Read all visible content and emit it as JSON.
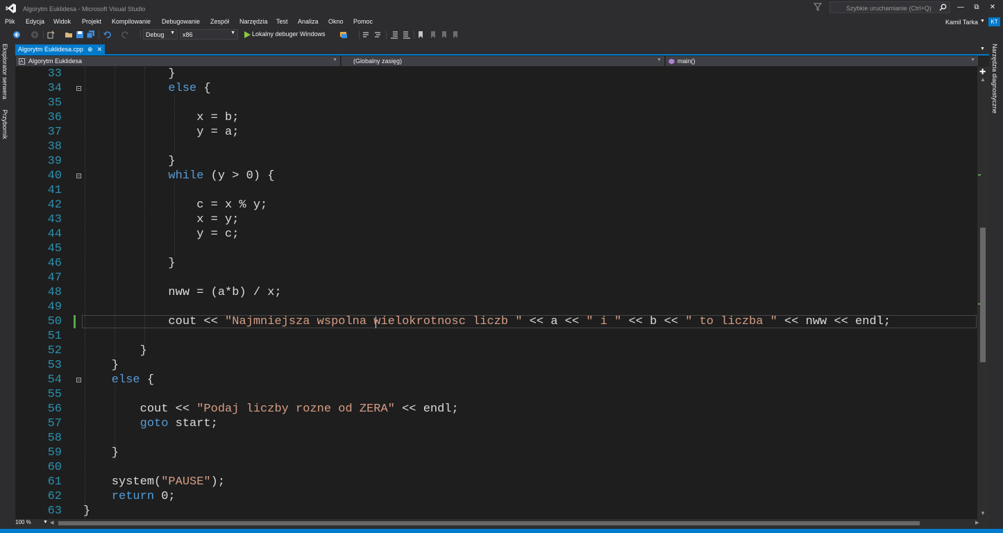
{
  "window": {
    "title": "Algorytm Euklidesa - Microsoft Visual Studio",
    "quick_launch_placeholder": "Szybkie uruchamianie (Ctrl+Q)"
  },
  "menu": [
    "Plik",
    "Edycja",
    "Widok",
    "Projekt",
    "Kompilowanie",
    "Debugowanie",
    "Zespół",
    "Narzędzia",
    "Test",
    "Analiza",
    "Okno",
    "Pomoc"
  ],
  "user": {
    "name": "Kamil Tarka",
    "initials": "KT"
  },
  "toolbar": {
    "config": "Debug",
    "platform": "x86",
    "run_label": "Lokalny debuger Windows"
  },
  "side_left": [
    "Eksplorator serwera",
    "Przybornik"
  ],
  "side_right": [
    "Narzędzia diagnostyczne"
  ],
  "tab": {
    "label": "Algorytm Euklidesa.cpp",
    "pin": "⊕",
    "close": "✕"
  },
  "navbar": {
    "project": "Algorytm Euklidesa",
    "scope": "(Globalny zasięg)",
    "member": "main()"
  },
  "zoom": "100 %",
  "code_lines": [
    {
      "num": "33",
      "segs": [
        [
          "",
          "            }"
        ]
      ]
    },
    {
      "num": "34",
      "segs": [
        [
          "kw",
          "            else"
        ],
        [
          "",
          " {"
        ]
      ]
    },
    {
      "num": "35",
      "segs": [
        [
          "",
          ""
        ]
      ]
    },
    {
      "num": "36",
      "segs": [
        [
          "",
          "                x = b;"
        ]
      ]
    },
    {
      "num": "37",
      "segs": [
        [
          "",
          "                y = a;"
        ]
      ]
    },
    {
      "num": "38",
      "segs": [
        [
          "",
          ""
        ]
      ]
    },
    {
      "num": "39",
      "segs": [
        [
          "",
          "            }"
        ]
      ]
    },
    {
      "num": "40",
      "segs": [
        [
          "kw",
          "            while"
        ],
        [
          "",
          " (y > 0) {"
        ]
      ]
    },
    {
      "num": "41",
      "segs": [
        [
          "",
          ""
        ]
      ]
    },
    {
      "num": "42",
      "segs": [
        [
          "",
          "                c = x % y;"
        ]
      ]
    },
    {
      "num": "43",
      "segs": [
        [
          "",
          "                x = y;"
        ]
      ]
    },
    {
      "num": "44",
      "segs": [
        [
          "",
          "                y = c;"
        ]
      ]
    },
    {
      "num": "45",
      "segs": [
        [
          "",
          ""
        ]
      ]
    },
    {
      "num": "46",
      "segs": [
        [
          "",
          "            }"
        ]
      ]
    },
    {
      "num": "47",
      "segs": [
        [
          "",
          ""
        ]
      ]
    },
    {
      "num": "48",
      "segs": [
        [
          "",
          "            nww = (a*b) / x;"
        ]
      ]
    },
    {
      "num": "49",
      "segs": [
        [
          "",
          ""
        ]
      ]
    },
    {
      "num": "50",
      "segs": [
        [
          "",
          "            cout << "
        ],
        [
          "str",
          "\"Najmniejsza wspolna wielokrotnosc liczb \""
        ],
        [
          "",
          " << a << "
        ],
        [
          "str",
          "\" i \""
        ],
        [
          "",
          " << b << "
        ],
        [
          "str",
          "\" to liczba \""
        ],
        [
          "",
          " << nww << endl;"
        ]
      ]
    },
    {
      "num": "51",
      "segs": [
        [
          "",
          ""
        ]
      ]
    },
    {
      "num": "52",
      "segs": [
        [
          "",
          "        }"
        ]
      ]
    },
    {
      "num": "53",
      "segs": [
        [
          "",
          "    }"
        ]
      ]
    },
    {
      "num": "54",
      "segs": [
        [
          "kw",
          "    else"
        ],
        [
          "",
          " {"
        ]
      ]
    },
    {
      "num": "55",
      "segs": [
        [
          "",
          ""
        ]
      ]
    },
    {
      "num": "56",
      "segs": [
        [
          "",
          "        cout << "
        ],
        [
          "str",
          "\"Podaj liczby rozne od ZERA\""
        ],
        [
          "",
          " << endl;"
        ]
      ]
    },
    {
      "num": "57",
      "segs": [
        [
          "kw",
          "        goto"
        ],
        [
          "",
          " start;"
        ]
      ]
    },
    {
      "num": "58",
      "segs": [
        [
          "",
          ""
        ]
      ]
    },
    {
      "num": "59",
      "segs": [
        [
          "",
          "    }"
        ]
      ]
    },
    {
      "num": "60",
      "segs": [
        [
          "",
          ""
        ]
      ]
    },
    {
      "num": "61",
      "segs": [
        [
          "",
          "    system("
        ],
        [
          "str",
          "\"PAUSE\""
        ],
        [
          "",
          ");"
        ]
      ]
    },
    {
      "num": "62",
      "segs": [
        [
          "kw",
          "    return"
        ],
        [
          "",
          " 0;"
        ]
      ]
    },
    {
      "num": "63",
      "segs": [
        [
          "",
          "}"
        ]
      ]
    }
  ],
  "colors": {
    "accent": "#007acc",
    "keyword": "#569cd6",
    "string": "#d69d85",
    "line_number": "#2b91af",
    "text": "#dcdcdc",
    "editor_bg": "#1e1e1e",
    "change_mark": "#57a64a"
  }
}
